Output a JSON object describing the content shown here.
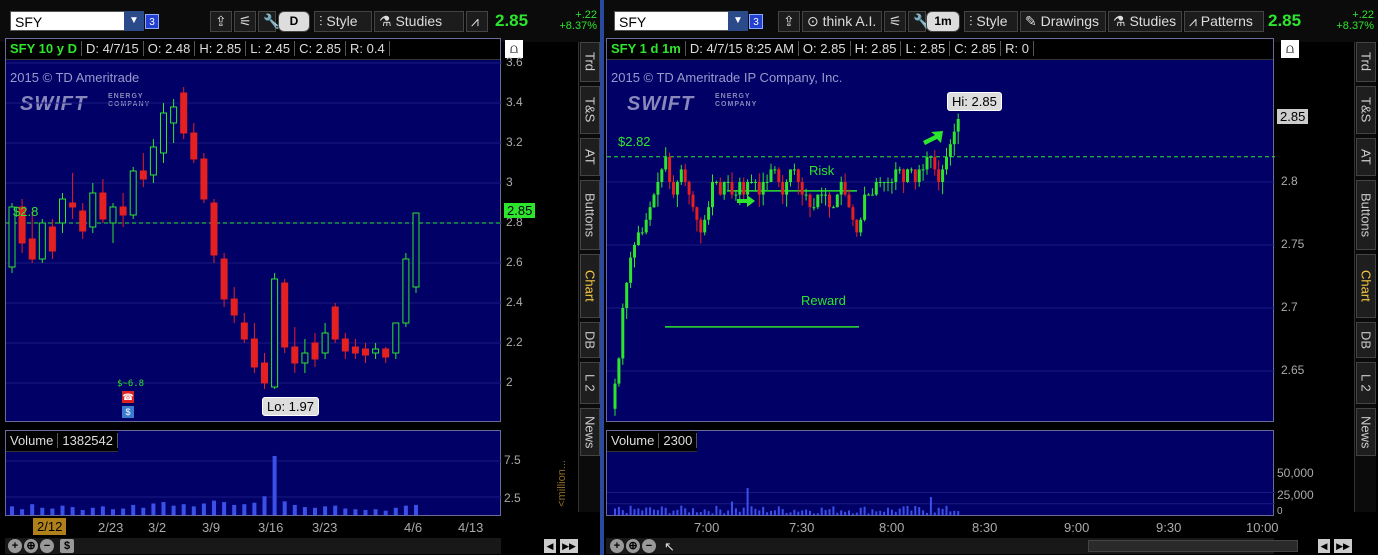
{
  "left": {
    "symbol": "SFY",
    "link_num": "3",
    "agg_btn": "D",
    "style_label": "Style",
    "studies_label": "Studies",
    "last": "2.85",
    "chg": "+.22",
    "chg_pct": "+8.37%",
    "title": "SFY 10 y D",
    "date": "D: 4/7/15",
    "open": "O: 2.48",
    "high": "H: 2.85",
    "low": "L: 2.45",
    "close": "C: 2.85",
    "range": "R: 0.4",
    "copyright": "2015 © TD Ameritrade",
    "logo": "SWIFT",
    "logo_sub": "ENERGY COMPANY",
    "yticks": [
      "3.6",
      "3.4",
      "3.2",
      "3",
      "2.8",
      "2.6",
      "2.4",
      "2.2",
      "2"
    ],
    "price_tag": "2.85",
    "line_label": "$2.8",
    "lo_bubble": "Lo: 1.97",
    "div_label": "$~6.8",
    "vol_label": "Volume",
    "vol_value": "1382542",
    "vol_ticks": [
      "7.5",
      "2.5"
    ],
    "vol_unit": "<million...",
    "xticks": [
      "2/23",
      "3/2",
      "3/9",
      "3/16",
      "3/23",
      "4/6",
      "4/13"
    ],
    "cursor_date": "2/12",
    "candles": [
      {
        "o": 2.58,
        "h": 2.9,
        "l": 2.55,
        "c": 2.88
      },
      {
        "o": 2.88,
        "h": 2.92,
        "l": 2.65,
        "c": 2.7
      },
      {
        "o": 2.72,
        "h": 2.86,
        "l": 2.6,
        "c": 2.62
      },
      {
        "o": 2.62,
        "h": 2.82,
        "l": 2.6,
        "c": 2.8
      },
      {
        "o": 2.78,
        "h": 2.82,
        "l": 2.62,
        "c": 2.66
      },
      {
        "o": 2.8,
        "h": 2.95,
        "l": 2.75,
        "c": 2.92
      },
      {
        "o": 2.9,
        "h": 3.05,
        "l": 2.82,
        "c": 2.88
      },
      {
        "o": 2.86,
        "h": 2.9,
        "l": 2.72,
        "c": 2.76
      },
      {
        "o": 2.78,
        "h": 3.0,
        "l": 2.75,
        "c": 2.95
      },
      {
        "o": 2.95,
        "h": 3.02,
        "l": 2.8,
        "c": 2.82
      },
      {
        "o": 2.8,
        "h": 2.9,
        "l": 2.7,
        "c": 2.88
      },
      {
        "o": 2.88,
        "h": 2.95,
        "l": 2.78,
        "c": 2.84
      },
      {
        "o": 2.84,
        "h": 3.08,
        "l": 2.82,
        "c": 3.06
      },
      {
        "o": 3.06,
        "h": 3.15,
        "l": 2.98,
        "c": 3.02
      },
      {
        "o": 3.04,
        "h": 3.22,
        "l": 3.0,
        "c": 3.18
      },
      {
        "o": 3.15,
        "h": 3.4,
        "l": 3.1,
        "c": 3.35
      },
      {
        "o": 3.3,
        "h": 3.42,
        "l": 3.2,
        "c": 3.38
      },
      {
        "o": 3.45,
        "h": 3.48,
        "l": 3.22,
        "c": 3.25
      },
      {
        "o": 3.25,
        "h": 3.3,
        "l": 3.1,
        "c": 3.12
      },
      {
        "o": 3.12,
        "h": 3.15,
        "l": 2.9,
        "c": 2.92
      },
      {
        "o": 2.9,
        "h": 2.92,
        "l": 2.6,
        "c": 2.64
      },
      {
        "o": 2.62,
        "h": 2.65,
        "l": 2.38,
        "c": 2.42
      },
      {
        "o": 2.42,
        "h": 2.48,
        "l": 2.3,
        "c": 2.34
      },
      {
        "o": 2.3,
        "h": 2.35,
        "l": 2.2,
        "c": 2.22
      },
      {
        "o": 2.22,
        "h": 2.3,
        "l": 2.05,
        "c": 2.08
      },
      {
        "o": 2.1,
        "h": 2.15,
        "l": 1.97,
        "c": 2.0
      },
      {
        "o": 1.98,
        "h": 2.55,
        "l": 1.97,
        "c": 2.52
      },
      {
        "o": 2.5,
        "h": 2.52,
        "l": 2.15,
        "c": 2.18
      },
      {
        "o": 2.18,
        "h": 2.28,
        "l": 2.05,
        "c": 2.1
      },
      {
        "o": 2.1,
        "h": 2.22,
        "l": 2.05,
        "c": 2.15
      },
      {
        "o": 2.2,
        "h": 2.25,
        "l": 2.08,
        "c": 2.12
      },
      {
        "o": 2.15,
        "h": 2.3,
        "l": 2.12,
        "c": 2.25
      },
      {
        "o": 2.38,
        "h": 2.4,
        "l": 2.2,
        "c": 2.22
      },
      {
        "o": 2.22,
        "h": 2.25,
        "l": 2.12,
        "c": 2.16
      },
      {
        "o": 2.18,
        "h": 2.22,
        "l": 2.12,
        "c": 2.15
      },
      {
        "o": 2.17,
        "h": 2.2,
        "l": 2.1,
        "c": 2.14
      },
      {
        "o": 2.15,
        "h": 2.2,
        "l": 2.12,
        "c": 2.17
      },
      {
        "o": 2.17,
        "h": 2.18,
        "l": 2.1,
        "c": 2.13
      },
      {
        "o": 2.15,
        "h": 2.3,
        "l": 2.12,
        "c": 2.3
      },
      {
        "o": 2.3,
        "h": 2.65,
        "l": 2.28,
        "c": 2.62
      },
      {
        "o": 2.48,
        "h": 2.85,
        "l": 2.45,
        "c": 2.85
      }
    ],
    "volumes": [
      1.2,
      0.8,
      1.5,
      1.0,
      0.9,
      1.3,
      1.1,
      0.7,
      1.0,
      1.2,
      0.8,
      0.9,
      1.4,
      1.0,
      1.6,
      1.8,
      1.3,
      1.5,
      1.2,
      1.6,
      2.0,
      1.8,
      1.4,
      1.5,
      1.7,
      2.6,
      8.2,
      1.9,
      1.4,
      1.1,
      1.0,
      1.2,
      1.3,
      0.9,
      0.8,
      0.7,
      0.8,
      0.6,
      1.0,
      1.3,
      1.4
    ]
  },
  "right": {
    "symbol": "SFY",
    "link_num": "3",
    "thinkai_label": "think A.I.",
    "agg_btn": "1m",
    "style_label": "Style",
    "drawings_label": "Drawings",
    "studies_label": "Studies",
    "patterns_label": "Patterns",
    "last": "2.85",
    "chg": "+.22",
    "chg_pct": "+8.37%",
    "title": "SFY 1 d 1m",
    "date": "D: 4/7/15 8:25 AM",
    "open": "O: 2.85",
    "high": "H: 2.85",
    "low": "L: 2.85",
    "close": "C: 2.85",
    "range": "R: 0",
    "copyright": "2015 © TD Ameritrade IP Company, Inc.",
    "logo": "SWIFT",
    "logo_sub": "ENERGY COMPANY",
    "yticks": [
      "2.8",
      "2.75",
      "2.7",
      "2.65"
    ],
    "price_tag": "2.85",
    "line_label": "$2.82",
    "hi_bubble": "Hi: 2.85",
    "risk_label": "Risk",
    "reward_label": "Reward",
    "vol_label": "Volume",
    "vol_value": "2300",
    "vol_ticks": [
      "50,000",
      "25,000",
      "0"
    ],
    "xticks": [
      "7:00",
      "7:30",
      "8:00",
      "8:30",
      "9:00",
      "9:30",
      "10:00"
    ]
  },
  "side_tabs_left": [
    "Trd",
    "T&S",
    "AT",
    "Buttons",
    "Chart",
    "DB",
    "L 2",
    "News"
  ],
  "side_tabs_right": [
    "Trd",
    "T&S",
    "AT",
    "Buttons",
    "Chart",
    "DB",
    "L 2",
    "News"
  ]
}
